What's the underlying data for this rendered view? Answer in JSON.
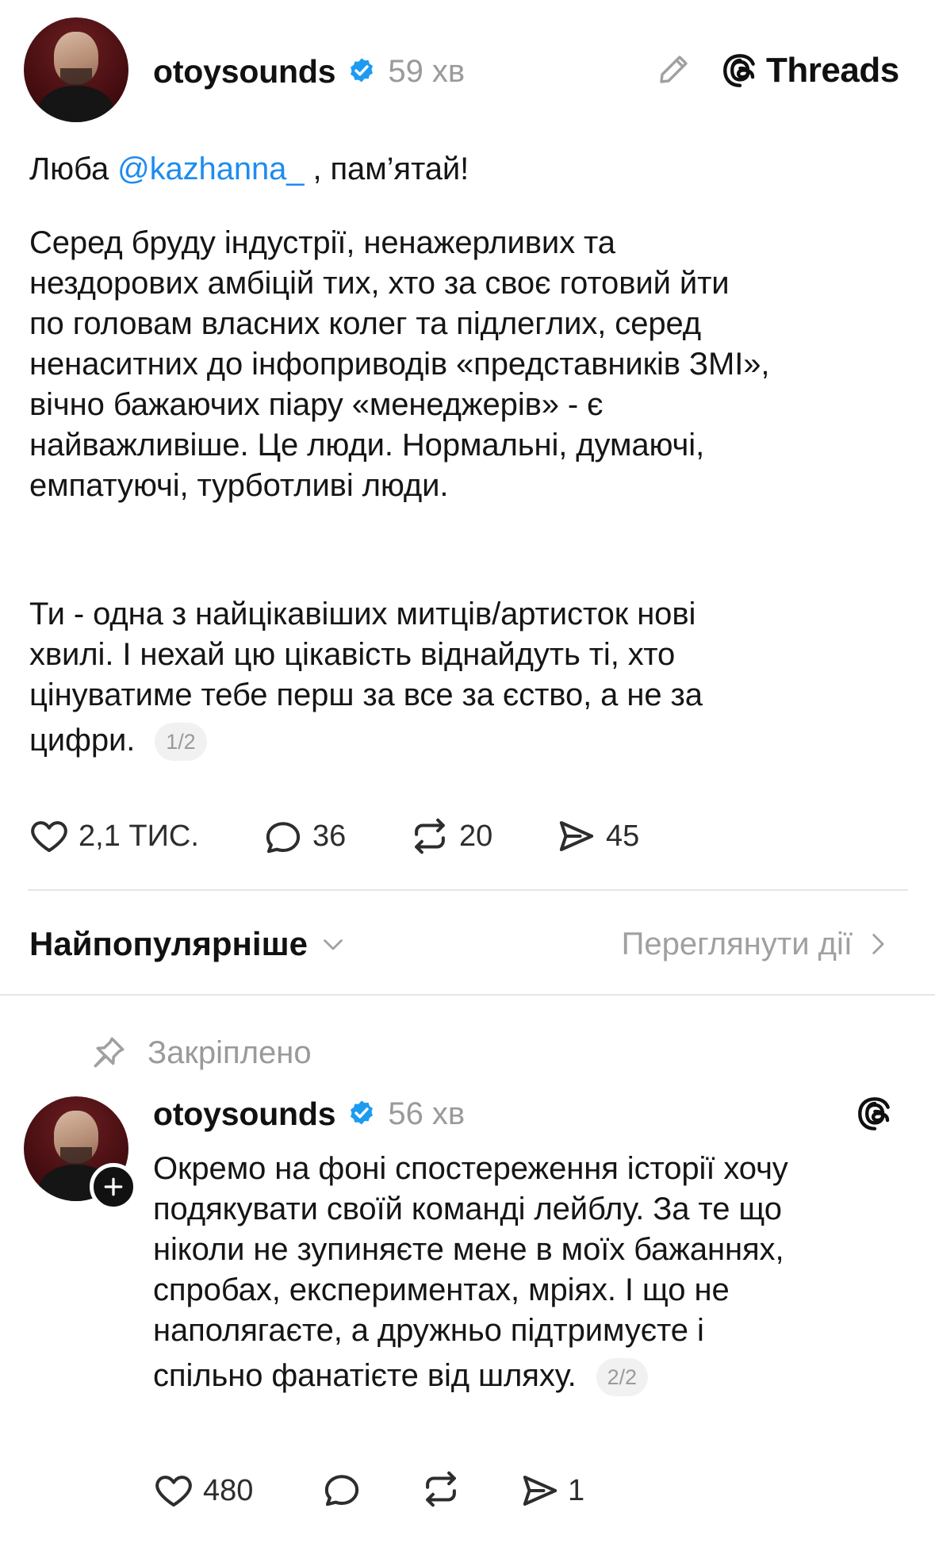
{
  "post": {
    "username": "otoysounds",
    "timestamp": "59 хв",
    "brand": "Threads",
    "greeting_prefix": "Люба",
    "mention": "@kazhanna_",
    "greeting_suffix": ", пам’ятай!",
    "paragraph2_lines": [
      "Серед бруду індустрії, ненажерливих та",
      "нездорових амбіцій тих, хто за своє готовий йти",
      "по головам власних колег та підлеглих, серед",
      "ненаситних до інфоприводів «представників ЗМІ»,",
      "вічно бажаючих піару «менеджерів» - є",
      "найважливіше. Це люди. Нормальні, думаючі,",
      "емпатуючі, турботливі люди."
    ],
    "paragraph3_lines": [
      "Ти - одна з найцікавіших митців/артисток нові",
      "хвилі. І нехай цю цікавість віднайдуть ті, хто",
      "цінуватиме тебе перш за все за єство, а не за"
    ],
    "paragraph3_last": "цифри.",
    "pager": "1/2",
    "stats": {
      "likes": "2,1 ТИС.",
      "replies": "36",
      "reposts": "20",
      "shares": "45"
    }
  },
  "sort": {
    "label": "Найпопулярніше",
    "view_activity": "Переглянути дії"
  },
  "reply": {
    "pinned_label": "Закріплено",
    "username": "otoysounds",
    "timestamp": "56 хв",
    "lines": [
      "Окремо на фоні спостереження історії хочу",
      "подякувати своїй команді лейблу. За те що",
      "ніколи не зупиняєте мене в моїх бажаннях,",
      "спробах, експериментах, мріях. І що не",
      "наполягаєте, а дружньо підтримуєте і"
    ],
    "last_line": "спільно фанатієте від шляху.",
    "pager": "2/2",
    "stats": {
      "likes": "480",
      "shares": "1"
    }
  },
  "colors": {
    "mention": "#1d8cf0",
    "verified": "#1d9bf0",
    "muted": "#9a9a9a"
  }
}
